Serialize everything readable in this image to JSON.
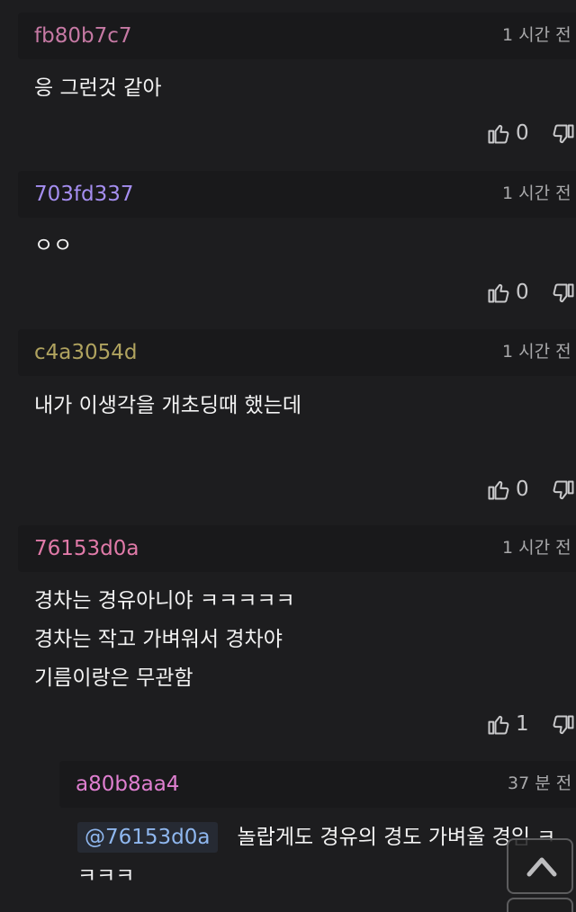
{
  "colors": {
    "background": "#1d1d1f",
    "header_bg": "#19191b",
    "text": "#f3f3f3",
    "meta": "#a9a9ab",
    "mention": "#8fb7ef"
  },
  "comments": [
    {
      "author": "fb80b7c7",
      "author_color": "#c679a4",
      "time": "1 시간 전",
      "lines": [
        "응 그런것 같아"
      ],
      "likes": "0"
    },
    {
      "author": "703fd337",
      "author_color": "#a58ef0",
      "time": "1 시간 전",
      "lines": [
        "ㅇㅇ"
      ],
      "likes": "0"
    },
    {
      "author": "c4a3054d",
      "author_color": "#b0a35f",
      "time": "1 시간 전",
      "lines": [
        "내가 이생각을 개초딩때 했는데"
      ],
      "likes": "0"
    },
    {
      "author": "76153d0a",
      "author_color": "#e07aa8",
      "time": "1 시간 전",
      "lines": [
        "경차는 경유아니야 ㅋㅋㅋㅋㅋ",
        "경차는 작고 가벼워서 경차야",
        "기름이랑은 무관함"
      ],
      "likes": "1"
    }
  ],
  "reply": {
    "author": "a80b8aa4",
    "author_color": "#df7fd0",
    "time": "37 분 전",
    "mention": "@76153d0a",
    "text": "놀랍게도 경유의 경도 가벼울 경임 ㅋ",
    "text_line2": "ㅋㅋㅋ"
  },
  "icons": {
    "like": "thumbs-up-icon",
    "dislike": "thumbs-down-icon",
    "scroll_top": "chevron-up-icon"
  }
}
